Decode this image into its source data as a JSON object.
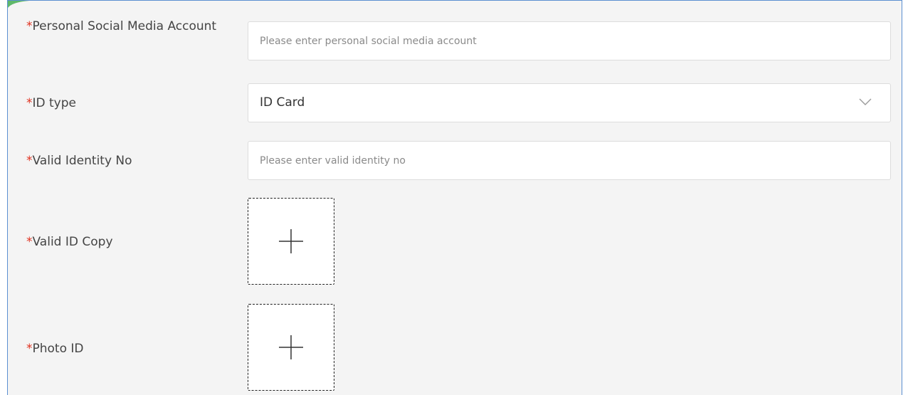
{
  "form": {
    "required_mark": "*",
    "social_media": {
      "label": "Personal Social Media Account",
      "placeholder": "Please enter personal social media account",
      "value": ""
    },
    "id_type": {
      "label": "ID type",
      "selected": "ID Card"
    },
    "identity_no": {
      "label": "Valid Identity No",
      "placeholder": "Please enter valid identity no",
      "value": ""
    },
    "id_copy": {
      "label": "Valid ID Copy"
    },
    "photo_id": {
      "label": "Photo ID"
    }
  },
  "icons": {
    "dropdown": "chevron-down-icon",
    "upload": "plus-icon"
  },
  "colors": {
    "required": "#e0301e",
    "frame_border": "#5b8fd1",
    "background": "#f4f4f4"
  }
}
